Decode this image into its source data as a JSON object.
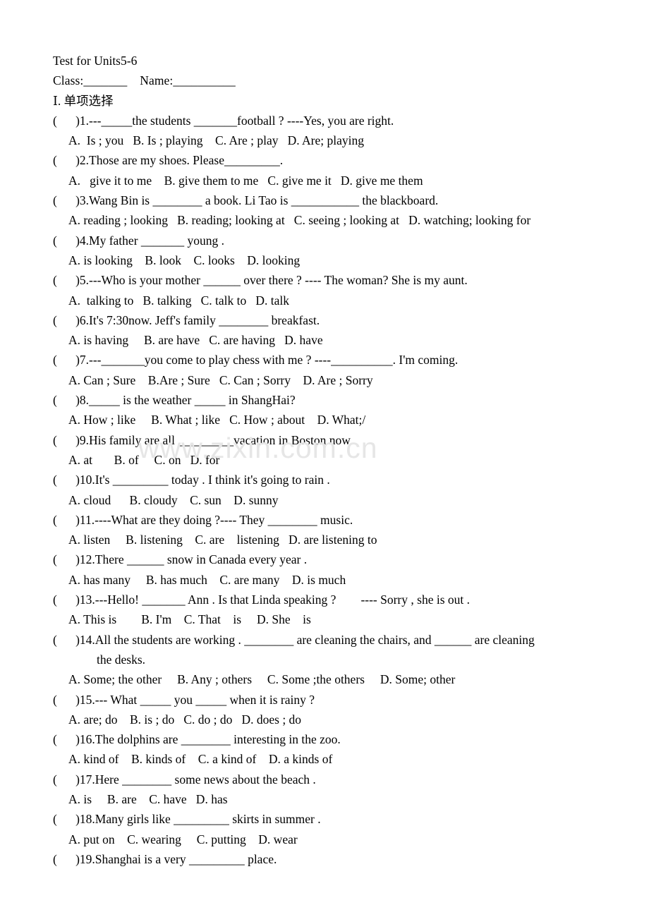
{
  "document": {
    "title": "Test for Units5-6",
    "info_line": "Class:_______    Name:__________",
    "section_label": "Ⅰ.  单项选择",
    "watermark": "www.zixin.com.cn",
    "questions": [
      {
        "stem": "(      )1.---_____the students _______football ? ----Yes, you are right.",
        "options": "A.  Is ; you   B. Is ; playing    C. Are ; play   D. Are; playing"
      },
      {
        "stem": "(      )2.Those are my shoes. Please_________.",
        "options": "A.   give it to me    B. give them to me   C. give me it   D. give me them"
      },
      {
        "stem": "(      )3.Wang Bin is ________ a book. Li Tao is ___________ the blackboard.",
        "options": "A. reading ; looking   B. reading; looking at   C. seeing ; looking at   D. watching; looking for"
      },
      {
        "stem": "(      )4.My father _______ young .",
        "options": "A. is looking    B. look    C. looks    D. looking"
      },
      {
        "stem": "(      )5.---Who is your mother ______ over there ? ---- The woman? She is my aunt.",
        "options": "A.  talking to   B. talking   C. talk to   D. talk"
      },
      {
        "stem": "(      )6.It's 7:30now. Jeff's family ________ breakfast.",
        "options": "A. is having     B. are have   C. are having   D. have"
      },
      {
        "stem": "(      )7.---_______you come to play chess with me ? ----__________. I'm coming.",
        "options": "A. Can ; Sure    B.Are ; Sure   C. Can ; Sorry    D. Are ; Sorry"
      },
      {
        "stem": "(      )8._____ is the weather _____ in ShangHai?",
        "options": "A. How ; like     B. What ; like   C. How ; about    D. What;/"
      },
      {
        "stem": "(      )9.His family are all _________vacation in Boston now.",
        "options": "A. at       B. of     C. on   D. for"
      },
      {
        "stem": "(      )10.It's _________ today . I think it's going to rain .",
        "options": "A. cloud      B. cloudy    C. sun    D. sunny"
      },
      {
        "stem": "(      )11.----What are they doing ?---- They ________ music.",
        "options": "A. listen     B. listening    C. are    listening   D. are listening to"
      },
      {
        "stem": "(      )12.There ______ snow in Canada every year .",
        "options": "A. has many     B. has much    C. are many    D. is much"
      },
      {
        "stem": "(      )13.---Hello! _______ Ann . Is that Linda speaking ?        ---- Sorry , she is out .",
        "options": "A. This is        B. I'm    C. That    is     D. She    is"
      },
      {
        "stem": "(      )14.All the students are working . ________ are cleaning the chairs, and ______ are cleaning",
        "continuation": "the desks.",
        "options": "A. Some; the other     B. Any ; others     C. Some ;the others     D. Some; other"
      },
      {
        "stem": "(      )15.--- What _____ you _____ when it is rainy ?",
        "options": "A. are; do    B. is ; do   C. do ; do   D. does ; do"
      },
      {
        "stem": "(      )16.The dolphins are ________ interesting in the zoo.",
        "options": "A. kind of    B. kinds of    C. a kind of    D. a kinds of"
      },
      {
        "stem": "(      )17.Here ________ some news about the beach .",
        "options": "A. is     B. are    C. have   D. has"
      },
      {
        "stem": "(      )18.Many girls like _________ skirts in summer .",
        "options": "A. put on    C. wearing     C. putting    D. wear"
      },
      {
        "stem": "(      )19.Shanghai is a very _________ place.",
        "options": ""
      }
    ]
  }
}
